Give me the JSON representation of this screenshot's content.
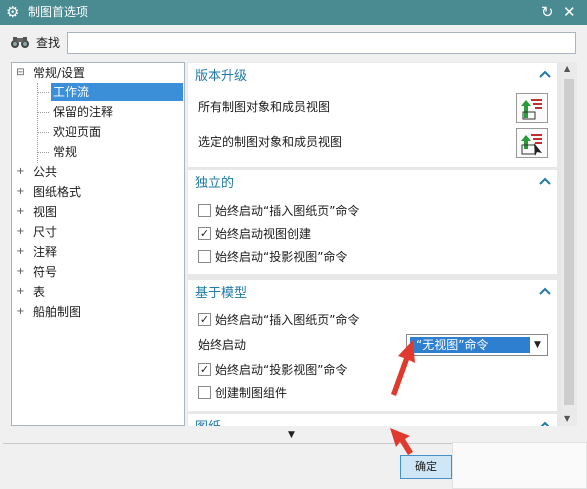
{
  "titlebar": {
    "title": "制图首选项",
    "gear_glyph": "⚙",
    "reset_glyph": "↻",
    "close_glyph": "✕"
  },
  "search": {
    "label": "查找",
    "icon": "binoculars-icon",
    "value": ""
  },
  "tree": {
    "items": [
      {
        "label": "常规/设置",
        "expander": "⊟"
      },
      {
        "label": "工作流",
        "selected": true
      },
      {
        "label": "保留的注释"
      },
      {
        "label": "欢迎页面"
      },
      {
        "label": "常规"
      },
      {
        "label": "公共",
        "expander": "+"
      },
      {
        "label": "图纸格式",
        "expander": "+"
      },
      {
        "label": "视图",
        "expander": "+"
      },
      {
        "label": "尺寸",
        "expander": "+"
      },
      {
        "label": "注释",
        "expander": "+"
      },
      {
        "label": "符号",
        "expander": "+"
      },
      {
        "label": "表",
        "expander": "+"
      },
      {
        "label": "船舶制图",
        "expander": "+"
      }
    ]
  },
  "sections": {
    "upgrade": {
      "title": "版本升级",
      "row1": "所有制图对象和成员视图",
      "row2": "选定的制图对象和成员视图"
    },
    "standalone": {
      "title": "独立的",
      "opt1": {
        "label": "始终启动“插入图纸页”命令",
        "checked": false
      },
      "opt2": {
        "label": "始终启动视图创建",
        "checked": true
      },
      "opt3": {
        "label": "始终启动“投影视图”命令",
        "checked": false
      }
    },
    "model_based": {
      "title": "基于模型",
      "opt1": {
        "label": "始终启动“插入图纸页”命令",
        "checked": true
      },
      "start_label": "始终启动",
      "start_value": "“无视图”命令",
      "opt2": {
        "label": "始终启动“投影视图”命令",
        "checked": true
      },
      "opt3": {
        "label": "创建制图组件",
        "checked": false
      }
    },
    "sheet": {
      "title": "图纸"
    }
  },
  "check_glyph": "✓",
  "collapse_glyph": "^",
  "dropdown_arrow_glyph": "▼",
  "more_glyph": "▼",
  "ok_label": "确定",
  "colors": {
    "titlebar": "#4a8a91",
    "section_title": "#1f7aa6",
    "selection": "#3b8fd8",
    "annotation_arrow": "#e03a2e"
  }
}
